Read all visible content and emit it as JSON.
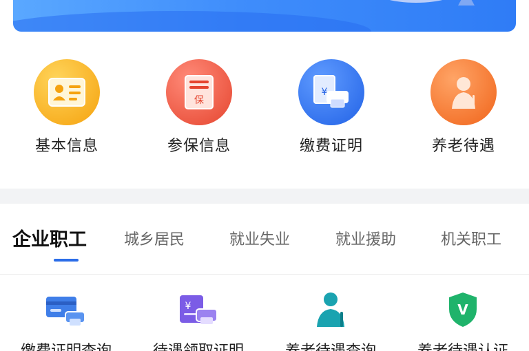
{
  "top_services": [
    {
      "label": "基本信息",
      "icon": "id-card-icon",
      "color": "#f5a20e"
    },
    {
      "label": "参保信息",
      "icon": "insurance-document-icon",
      "color": "#e5452f"
    },
    {
      "label": "缴费证明",
      "icon": "payment-printer-icon",
      "color": "#2262e6"
    },
    {
      "label": "养老待遇",
      "icon": "elderly-person-icon",
      "color": "#f0641a"
    }
  ],
  "tabs": [
    {
      "label": "企业职工",
      "active": true
    },
    {
      "label": "城乡居民",
      "active": false
    },
    {
      "label": "就业失业",
      "active": false
    },
    {
      "label": "就业援助",
      "active": false
    },
    {
      "label": "机关职工",
      "active": false
    }
  ],
  "sub_services": [
    {
      "label": "缴费证明查询",
      "icon": "card-printer-icon",
      "color": "#3f7ee8"
    },
    {
      "label": "待遇领取证明",
      "icon": "yuan-printer-icon",
      "color": "#7b5ce6"
    },
    {
      "label": "养老待遇查询",
      "icon": "elderly-person-icon",
      "color": "#1aa3b0"
    },
    {
      "label": "养老待遇认证",
      "icon": "shield-v-icon",
      "color": "#1fb36b"
    }
  ],
  "colors": {
    "accent": "#2b6de8",
    "divider": "#f2f3f5"
  }
}
